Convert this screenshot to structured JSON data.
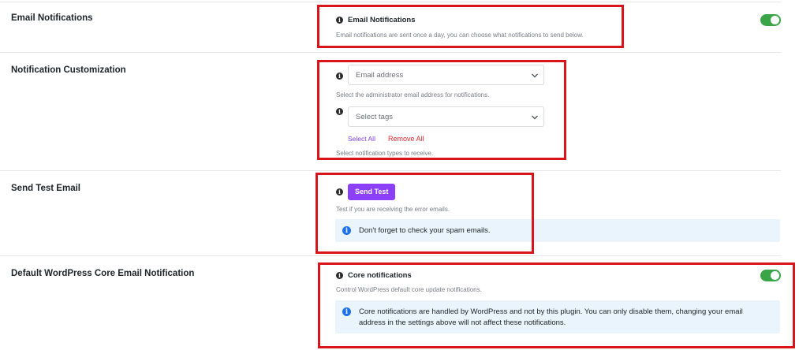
{
  "sections": {
    "email_notifications": {
      "label": "Email Notifications",
      "field_title": "Email Notifications",
      "help": "Email notifications are sent once a day, you can choose what notifications to send below.",
      "toggle_on": true
    },
    "customization": {
      "label": "Notification Customization",
      "email_select_placeholder": "Email address",
      "email_help": "Select the administrator email address for notifications.",
      "tags_select_placeholder": "Select tags",
      "select_all": "Select All",
      "remove_all": "Remove All",
      "tags_help": "Select notification types to receive."
    },
    "test_email": {
      "label": "Send Test Email",
      "button": "Send Test",
      "help": "Test if you are receiving the error emails.",
      "notice": "Don't forget to check your spam emails."
    },
    "core_notifications": {
      "label": "Default WordPress Core Email Notification",
      "field_title": "Core notifications",
      "help": "Control WordPress default core update notifications.",
      "toggle_on": true,
      "notice_line1": "Core notifications are handled by WordPress and not by this plugin. You can only disable them, changing your email",
      "notice_line2": "address in the settings above will not affect these notifications."
    }
  },
  "icons": {
    "info": "info-icon",
    "chevron": "chevron-down-icon",
    "notice": "info-circle-icon"
  },
  "colors": {
    "toggle_on": "#3aa546",
    "primary_button": "#8b3ff6",
    "remove_link": "#e0262d",
    "select_all_link": "#7b3ff2",
    "notice_bg": "#eaf4fc",
    "annotation_box": "#d9141b"
  }
}
